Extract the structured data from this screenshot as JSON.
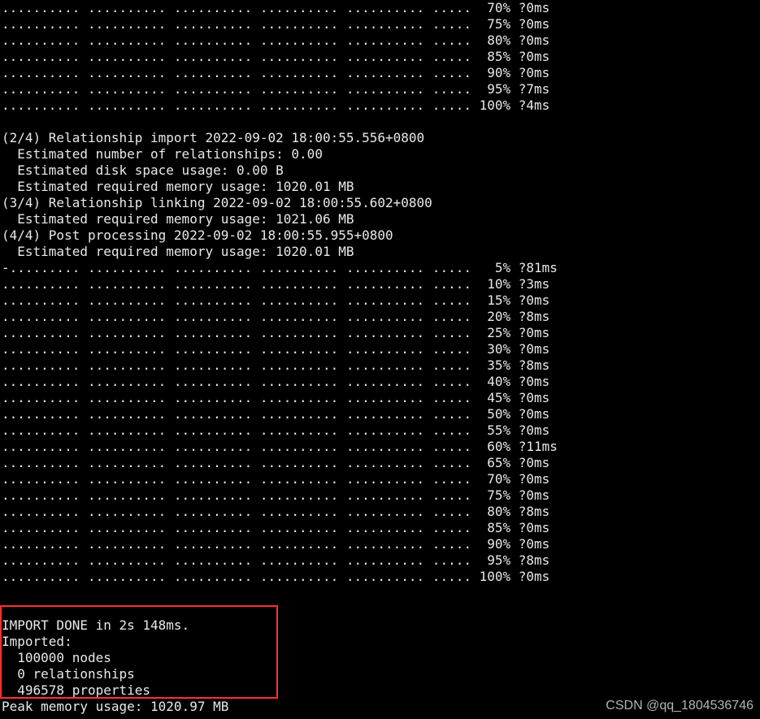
{
  "top_progress": [
    {
      "pct": "70%",
      "time": "?0ms"
    },
    {
      "pct": "75%",
      "time": "?0ms"
    },
    {
      "pct": "80%",
      "time": "?0ms"
    },
    {
      "pct": "85%",
      "time": "?0ms"
    },
    {
      "pct": "90%",
      "time": "?0ms"
    },
    {
      "pct": "95%",
      "time": "?7ms"
    },
    {
      "pct": "100%",
      "time": "?4ms"
    }
  ],
  "step2": {
    "header": "(2/4) Relationship import 2022-09-02 18:00:55.556+0800",
    "rel_count": "  Estimated number of relationships: 0.00",
    "disk": "  Estimated disk space usage: 0.00 B",
    "mem": "  Estimated required memory usage: 1020.01 MB"
  },
  "step3": {
    "header": "(3/4) Relationship linking 2022-09-02 18:00:55.602+0800",
    "mem": "  Estimated required memory usage: 1021.06 MB"
  },
  "step4": {
    "header": "(4/4) Post processing 2022-09-02 18:00:55.955+0800",
    "mem": "  Estimated required memory usage: 1020.01 MB"
  },
  "bottom_progress": [
    {
      "pct": "5%",
      "time": "?81ms"
    },
    {
      "pct": "10%",
      "time": "?3ms"
    },
    {
      "pct": "15%",
      "time": "?0ms"
    },
    {
      "pct": "20%",
      "time": "?8ms"
    },
    {
      "pct": "25%",
      "time": "?0ms"
    },
    {
      "pct": "30%",
      "time": "?0ms"
    },
    {
      "pct": "35%",
      "time": "?8ms"
    },
    {
      "pct": "40%",
      "time": "?0ms"
    },
    {
      "pct": "45%",
      "time": "?0ms"
    },
    {
      "pct": "50%",
      "time": "?0ms"
    },
    {
      "pct": "55%",
      "time": "?0ms"
    },
    {
      "pct": "60%",
      "time": "?11ms"
    },
    {
      "pct": "65%",
      "time": "?0ms"
    },
    {
      "pct": "70%",
      "time": "?0ms"
    },
    {
      "pct": "75%",
      "time": "?0ms"
    },
    {
      "pct": "80%",
      "time": "?8ms"
    },
    {
      "pct": "85%",
      "time": "?0ms"
    },
    {
      "pct": "90%",
      "time": "?0ms"
    },
    {
      "pct": "95%",
      "time": "?8ms"
    },
    {
      "pct": "100%",
      "time": "?0ms"
    }
  ],
  "result": {
    "blank1": "",
    "blank2": "",
    "done": "IMPORT DONE in 2s 148ms.",
    "imported": "Imported:",
    "nodes": "  100000 nodes",
    "rels": "  0 relationships",
    "props": "  496578 properties"
  },
  "peak_mem": "Peak memory usage: 1020.97 MB",
  "watermark": "CSDN @qq_1804536746"
}
